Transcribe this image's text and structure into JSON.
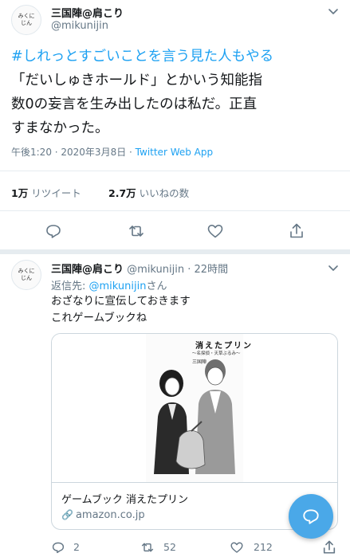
{
  "colors": {
    "accent": "#1da1f2",
    "secondary_text": "#657786",
    "divider": "#e6ecf0"
  },
  "main_tweet": {
    "avatar_text": [
      "みくに",
      "じん"
    ],
    "display_name": "三国陣@肩こり",
    "handle": "@mikunijin",
    "hashtag": "#しれっとすごいことを言う見た人もやる",
    "text_line1": "「だいしゅきホールド」とかいう知能指",
    "text_line2": "数0の妄言を生み出したのは私だ。正直",
    "text_line3": "すまなかった。",
    "timestamp": "午後1:20 · 2020年3月8日 · ",
    "source": "Twitter Web App",
    "retweet_count": "1万",
    "retweet_label": "リツイート",
    "like_count": "2.7万",
    "like_label": "いいねの数",
    "more_icon": "chevron-down-icon"
  },
  "reply_tweet": {
    "avatar_text": [
      "みくに",
      "じん"
    ],
    "display_name": "三国陣@肩こり",
    "handle": "@mikunijin",
    "time": "· 22時間",
    "reply_to_prefix": "返信先: ",
    "reply_to_handle": "@mikunijin",
    "reply_to_suffix": "さん",
    "text_line1": "おざなりに宣伝しておきます",
    "text_line2": "これゲームブックね",
    "card": {
      "cover_title": "消えたプリン",
      "cover_subtitle": "～名探偵・天草ぶるみ～",
      "cover_author": "三国陣",
      "title": "ゲームブック 消えたプリン",
      "domain": "amazon.co.jp"
    },
    "reply_count": "2",
    "retweet_count": "52",
    "like_count": "212"
  }
}
